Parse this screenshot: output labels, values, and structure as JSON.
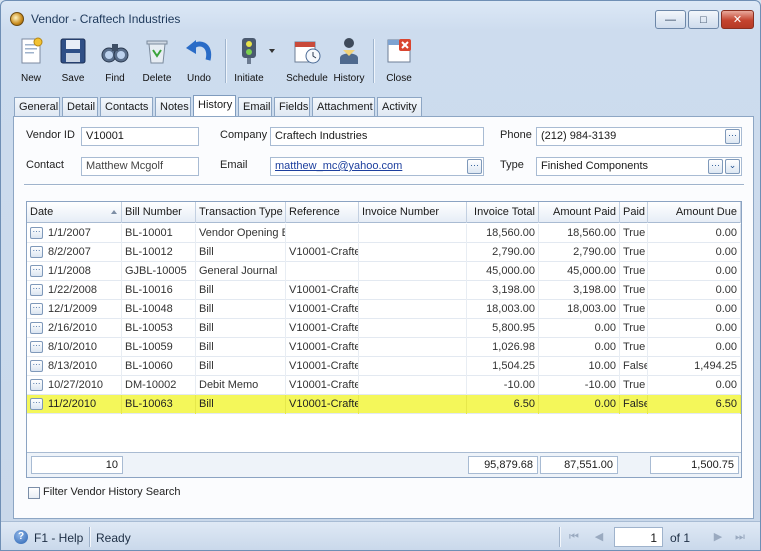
{
  "window": {
    "title": "Vendor - Craftech Industries"
  },
  "title_buttons": {
    "minimize": "—",
    "maximize": "□",
    "close": "✕"
  },
  "toolbar": [
    {
      "id": "new",
      "label": "New",
      "icon": "new-document-icon"
    },
    {
      "id": "save",
      "label": "Save",
      "icon": "floppy-disk-icon"
    },
    {
      "id": "find",
      "label": "Find",
      "icon": "binoculars-icon"
    },
    {
      "id": "delete",
      "label": "Delete",
      "icon": "recycle-bin-icon"
    },
    {
      "id": "undo",
      "label": "Undo",
      "icon": "undo-arrow-icon"
    },
    {
      "id": "initiate",
      "label": "Initiate",
      "icon": "traffic-light-icon"
    },
    {
      "id": "schedule",
      "label": "Schedule",
      "icon": "calendar-clock-icon"
    },
    {
      "id": "history",
      "label": "History",
      "icon": "hourglass-person-icon"
    },
    {
      "id": "close",
      "label": "Close",
      "icon": "close-window-icon"
    }
  ],
  "tabs": [
    "General",
    "Detail",
    "Contacts",
    "Notes",
    "History",
    "Email",
    "Fields",
    "Attachment",
    "Activity"
  ],
  "active_tab": "History",
  "form": {
    "vendor_id_label": "Vendor ID",
    "vendor_id": "V10001",
    "company_label": "Company",
    "company": "Craftech Industries",
    "phone_label": "Phone",
    "phone": "(212) 984-3139",
    "contact_label": "Contact",
    "contact": "Matthew Mcgolf",
    "email_label": "Email",
    "email": "matthew_mc@yahoo.com",
    "type_label": "Type",
    "type": "Finished Components"
  },
  "grid": {
    "columns": [
      "Date",
      "Bill Number",
      "Transaction Type",
      "Reference",
      "Invoice Number",
      "Invoice Total",
      "Amount Paid",
      "Paid",
      "Amount Due"
    ],
    "rows": [
      [
        "1/1/2007",
        "BL-10001",
        "Vendor Opening B",
        "",
        "",
        "18,560.00",
        "18,560.00",
        "True",
        "0.00"
      ],
      [
        "8/2/2007",
        "BL-10012",
        "Bill",
        "V10001-Crafte",
        "",
        "2,790.00",
        "2,790.00",
        "True",
        "0.00"
      ],
      [
        "1/1/2008",
        "GJBL-10005",
        "General Journal",
        "",
        "",
        "45,000.00",
        "45,000.00",
        "True",
        "0.00"
      ],
      [
        "1/22/2008",
        "BL-10016",
        "Bill",
        "V10001-Crafte",
        "",
        "3,198.00",
        "3,198.00",
        "True",
        "0.00"
      ],
      [
        "12/1/2009",
        "BL-10048",
        "Bill",
        "V10001-Crafte",
        "",
        "18,003.00",
        "18,003.00",
        "True",
        "0.00"
      ],
      [
        "2/16/2010",
        "BL-10053",
        "Bill",
        "V10001-Crafte",
        "",
        "5,800.95",
        "0.00",
        "True",
        "0.00"
      ],
      [
        "8/10/2010",
        "BL-10059",
        "Bill",
        "V10001-Crafte",
        "",
        "1,026.98",
        "0.00",
        "True",
        "0.00"
      ],
      [
        "8/13/2010",
        "BL-10060",
        "Bill",
        "V10001-Crafte",
        "",
        "1,504.25",
        "10.00",
        "False",
        "1,494.25"
      ],
      [
        "10/27/2010",
        "DM-10002",
        "Debit Memo",
        "V10001-Crafte",
        "",
        "-10.00",
        "-10.00",
        "True",
        "0.00"
      ],
      [
        "11/2/2010",
        "BL-10063",
        "Bill",
        "V10001-Crafte",
        "",
        "6.50",
        "0.00",
        "False",
        "6.50"
      ]
    ],
    "highlighted_row": 9,
    "footer": {
      "count": "10",
      "invoice_total": "95,879.68",
      "amount_paid": "87,551.00",
      "amount_due": "1,500.75"
    }
  },
  "filter_label": "Filter Vendor History Search",
  "status": {
    "help": "F1 - Help",
    "state": "Ready",
    "page": "1",
    "of_label": "of 1"
  },
  "colors": {
    "highlight": "#f4f75a",
    "accent": "#1d3f9e"
  }
}
